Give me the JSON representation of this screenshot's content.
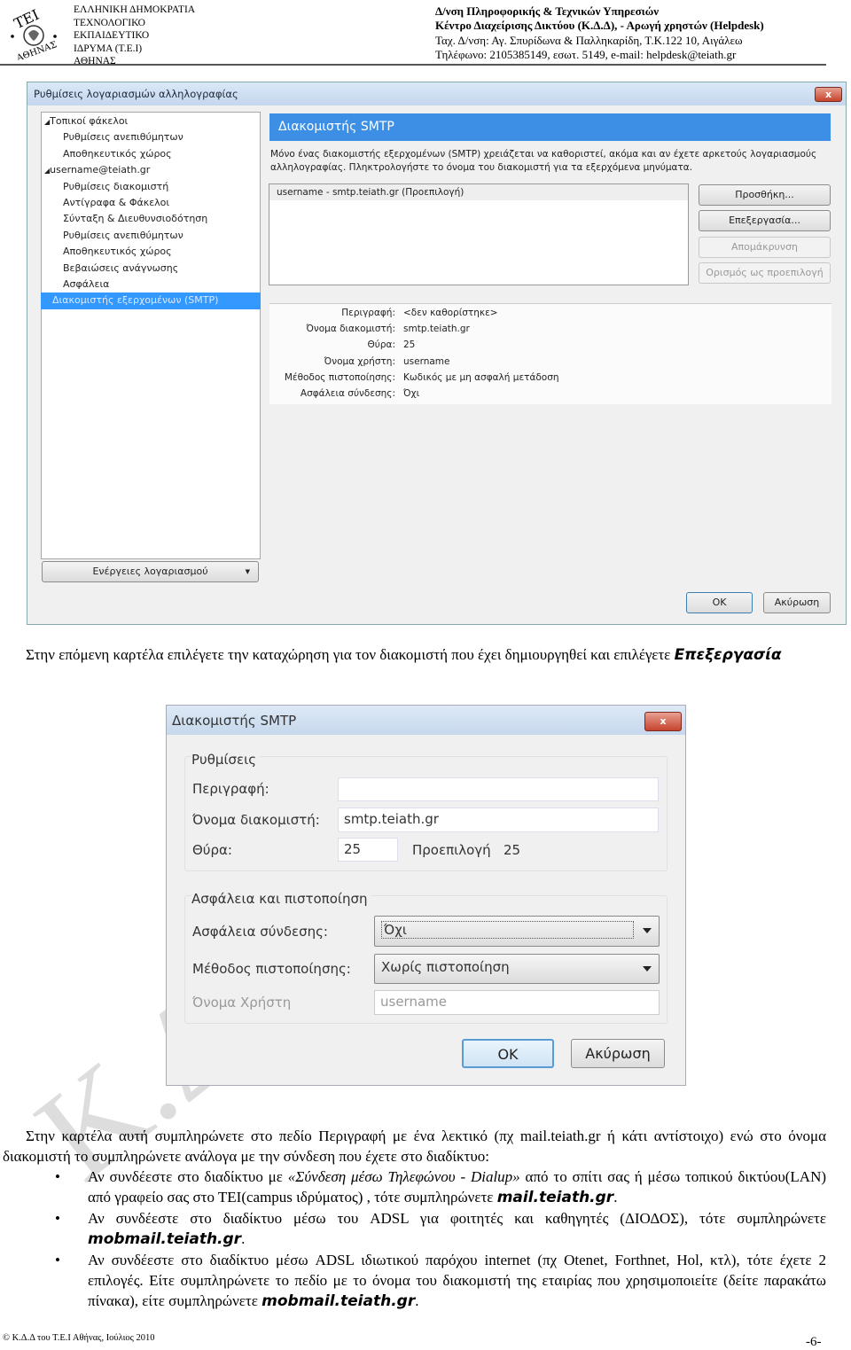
{
  "header": {
    "logo_text": "ΤΕΙ ΑΘΗΝΑΣ",
    "left_lines": [
      "ΕΛΛΗΝΙΚΗ ΔΗΜΟΚΡΑΤΙΑ",
      "ΤΕΧΝΟΛΟΓΙΚΟ",
      "ΕΚΠΑΙΔΕΥΤΙΚΟ",
      "ΙΔΡΥΜΑ (Τ.Ε.Ι)",
      "ΑΘΗΝΑΣ"
    ],
    "right_lines": [
      "Δ/νση Πληροφορικής & Τεχνικών Υπηρεσιών",
      "Κέντρο Διαχείρισης Δικτύου (Κ.Δ.Δ), - Αρωγή χρηστών (Helpdesk)",
      "Ταχ. Δ/νση: Αγ. Σπυρίδωνα & Παλληκαρίδη, Τ.Κ.122 10, Αιγάλεω",
      "Τηλέφωνο: 2105385149, εσωτ. 5149,  e-mail: helpdesk@teiath.gr"
    ]
  },
  "settings_window": {
    "title": "Ρυθμίσεις λογαριασμών αλληλογραφίας",
    "close": "x",
    "tree": [
      "Τοπικοί φάκελοι",
      "Ρυθμίσεις ανεπιθύμητων",
      "Αποθηκευτικός χώρος",
      "username@teiath.gr",
      "Ρυθμίσεις διακομιστή",
      "Αντίγραφα & Φάκελοι",
      "Σύνταξη & Διευθυνσιοδότηση",
      "Ρυθμίσεις ανεπιθύμητων",
      "Αποθηκευτικός χώρος",
      "Βεβαιώσεις ανάγνωσης",
      "Ασφάλεια",
      "Διακομιστής εξερχομένων (SMTP)"
    ],
    "account_actions": "Ενέργειες λογαριασμού",
    "panel_title": "Διακομιστής SMTP",
    "description": "Μόνο ένας διακομιστής εξερχομένων (SMTP) χρειάζεται να καθοριστεί, ακόμα και αν έχετε αρκετούς λογαριασμούς αλληλογραφίας. Πληκτρολογήστε το όνομα του διακομιστή για τα εξερχόμενα μηνύματα.",
    "server_list": [
      "username - smtp.teiath.gr (Προεπιλογή)"
    ],
    "buttons": {
      "add": "Προσθήκη...",
      "edit": "Επεξεργασία...",
      "remove": "Απομάκρυνση",
      "set_default": "Ορισμός ως προεπιλογή"
    },
    "details": [
      {
        "label": "Περιγραφή:",
        "value": "<δεν καθορίστηκε>"
      },
      {
        "label": "Όνομα διακομιστή:",
        "value": "smtp.teiath.gr"
      },
      {
        "label": "Θύρα:",
        "value": "25"
      },
      {
        "label": "Όνομα χρήστη:",
        "value": "username"
      },
      {
        "label": "Μέθοδος πιστοποίησης:",
        "value": "Κωδικός με μη ασφαλή μετάδοση"
      },
      {
        "label": "Ασφάλεια σύνδεσης:",
        "value": "Όχι"
      }
    ],
    "ok": "OK",
    "cancel": "Ακύρωση"
  },
  "para1": {
    "text": "Στην επόμενη καρτέλα επιλέγετε την καταχώρηση για τον διακομιστή που έχει δημιουργηθεί και επιλέγετε ",
    "bold": "Επεξεργασία"
  },
  "smtp_dialog": {
    "title": "Διακομιστής SMTP",
    "close": "x",
    "settings_group": "Ρυθμίσεις",
    "description_label": "Περιγραφή:",
    "description_value": "",
    "server_label": "Όνομα διακομιστή:",
    "server_value": "smtp.teiath.gr",
    "port_label": "Θύρα:",
    "port_value": "25",
    "default_label": "Προεπιλογή",
    "default_value": "25",
    "security_group": "Ασφάλεια και πιστοποίηση",
    "conn_security_label": "Ασφάλεια σύνδεσης:",
    "conn_security_value": "Όχι",
    "auth_label": "Μέθοδος πιστοποίησης:",
    "auth_value": "Χωρίς πιστοποίηση",
    "user_label": "Όνομα Χρήστη",
    "user_value": "username",
    "ok": "OK",
    "cancel": "Ακύρωση"
  },
  "watermark": "Κ.Δ.Δ",
  "para2": "Στην καρτέλα αυτή συμπληρώνετε στο πεδίο Περιγραφή με ένα λεκτικό (πχ mail.teiath.gr ή κάτι αντίστοιχο) ενώ στο όνομα διακομιστή το συμπληρώνετε ανάλογα με την σύνδεση που έχετε στο διαδίκτυο:",
  "bullets": [
    {
      "pre": "Αν συνδέεστε στο διαδίκτυο με ",
      "italic": "«Σύνδεση μέσω Τηλεφώνου - Dialup»",
      "mid": "  από το σπίτι σας ή μέσω τοπικού δικτύου(LAN) από γραφείο σας στο ΤΕΙ(campus ιδρύματος) , τότε συμπληρώνετε ",
      "bold": "mail.teiath.gr",
      "post": "."
    },
    {
      "pre": "Αν συνδέεστε στο διαδίκτυο μέσω του ADSL για φοιτητές και καθηγητές (ΔΙΟΔΟΣ), τότε  συμπληρώνετε ",
      "bold": "mobmail.teiath.gr",
      "post": "."
    },
    {
      "pre": "Αν συνδέεστε στο διαδίκτυο μέσω ADSL ιδιωτικού παρόχου internet (πχ Otenet, Forthnet, Hol, κτλ), τότε έχετε 2 επιλογές. Είτε συμπληρώνετε το πεδίο με το όνομα του διακομιστή της εταιρίας που χρησιμοποιείτε (δείτε παρακάτω πίνακα), είτε συμπληρώνετε ",
      "bold": "mobmail.teiath.gr",
      "post": "."
    }
  ],
  "footer": {
    "copyright": "© Κ.Δ.Δ του Τ.Ε.Ι Αθήνας, Ιούλιος 2010",
    "page": "-6-"
  }
}
